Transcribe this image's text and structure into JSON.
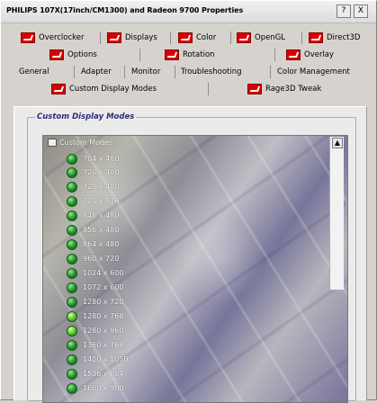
{
  "window": {
    "title": "PHILIPS 107X(17inch/CM1300) and Radeon 9700 Properties",
    "help_label": "?",
    "close_label": "X"
  },
  "tabs": {
    "row1": [
      "Overclocker",
      "Displays",
      "Color",
      "OpenGL",
      "Direct3D"
    ],
    "row2": [
      "Options",
      "Rotation",
      "Overlay"
    ],
    "row3": [
      "General",
      "Adapter",
      "Monitor",
      "Troubleshooting",
      "Color Management"
    ],
    "row4": [
      "Custom Display Modes",
      "Rage3D Tweak"
    ]
  },
  "panel": {
    "group_title": "Custom Display Modes",
    "list_header": "Custom Modes",
    "modes": [
      "704 x 480",
      "720 x 400",
      "720 x 480",
      "720 x 576",
      "848 x 480",
      "856 x 480",
      "864 x 480",
      "960 x 720",
      "1024 x 600",
      "1072 x 600",
      "1280 x 720",
      "1280 x 768",
      "1280 x 960",
      "1360 x 768",
      "1400 x 1050",
      "1536 x 864",
      "1600 x 900"
    ]
  },
  "icons": {
    "tab_icon": "red-display-icon",
    "mode_icon": "green-status-dot-icon",
    "scroll_up": "scroll-up-arrow-icon"
  },
  "colors": {
    "tab_icon": "#d80000",
    "group_title": "#2d2d78",
    "mode_green": "#1f8d2c"
  }
}
